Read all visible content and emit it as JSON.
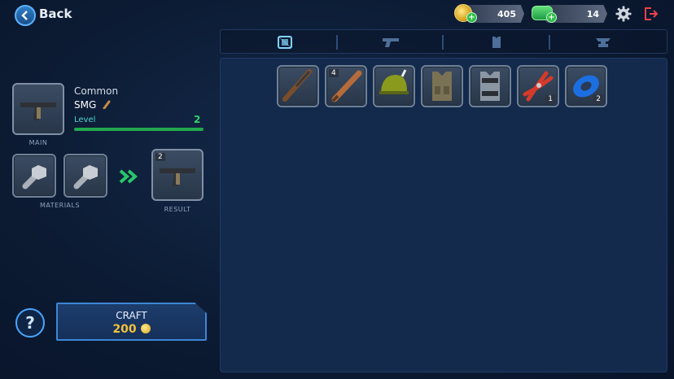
{
  "header": {
    "back_label": "Back",
    "coins": "405",
    "cash": "14"
  },
  "tabs": [
    {
      "name": "crate",
      "active": true
    },
    {
      "name": "weapons",
      "active": false
    },
    {
      "name": "armor",
      "active": false
    },
    {
      "name": "anvil",
      "active": false
    }
  ],
  "inventory": [
    {
      "icon": "shotgun-icon",
      "qty_tl": "",
      "qty_br": ""
    },
    {
      "icon": "baseball-bat-icon",
      "qty_tl": "4",
      "qty_br": ""
    },
    {
      "icon": "helmet-icon",
      "qty_tl": "",
      "qty_br": ""
    },
    {
      "icon": "tactical-vest-icon",
      "qty_tl": "",
      "qty_br": ""
    },
    {
      "icon": "body-armor-icon",
      "qty_tl": "",
      "qty_br": ""
    },
    {
      "icon": "pliers-icon",
      "qty_tl": "",
      "qty_br": "1"
    },
    {
      "icon": "duct-tape-icon",
      "qty_tl": "",
      "qty_br": "2"
    }
  ],
  "selected": {
    "rarity": "Common",
    "name": "SMG",
    "level_label": "Level",
    "level": "2",
    "main_caption": "MAIN"
  },
  "materials_caption": "MATERIALS",
  "result": {
    "qty": "2",
    "caption": "RESULT"
  },
  "craft": {
    "label": "CRAFT",
    "cost": "200"
  },
  "help_label": "?",
  "colors": {
    "accent": "#4aa6ff",
    "level": "#32d36a",
    "gold": "#f3c13a",
    "exit": "#e8424a"
  }
}
